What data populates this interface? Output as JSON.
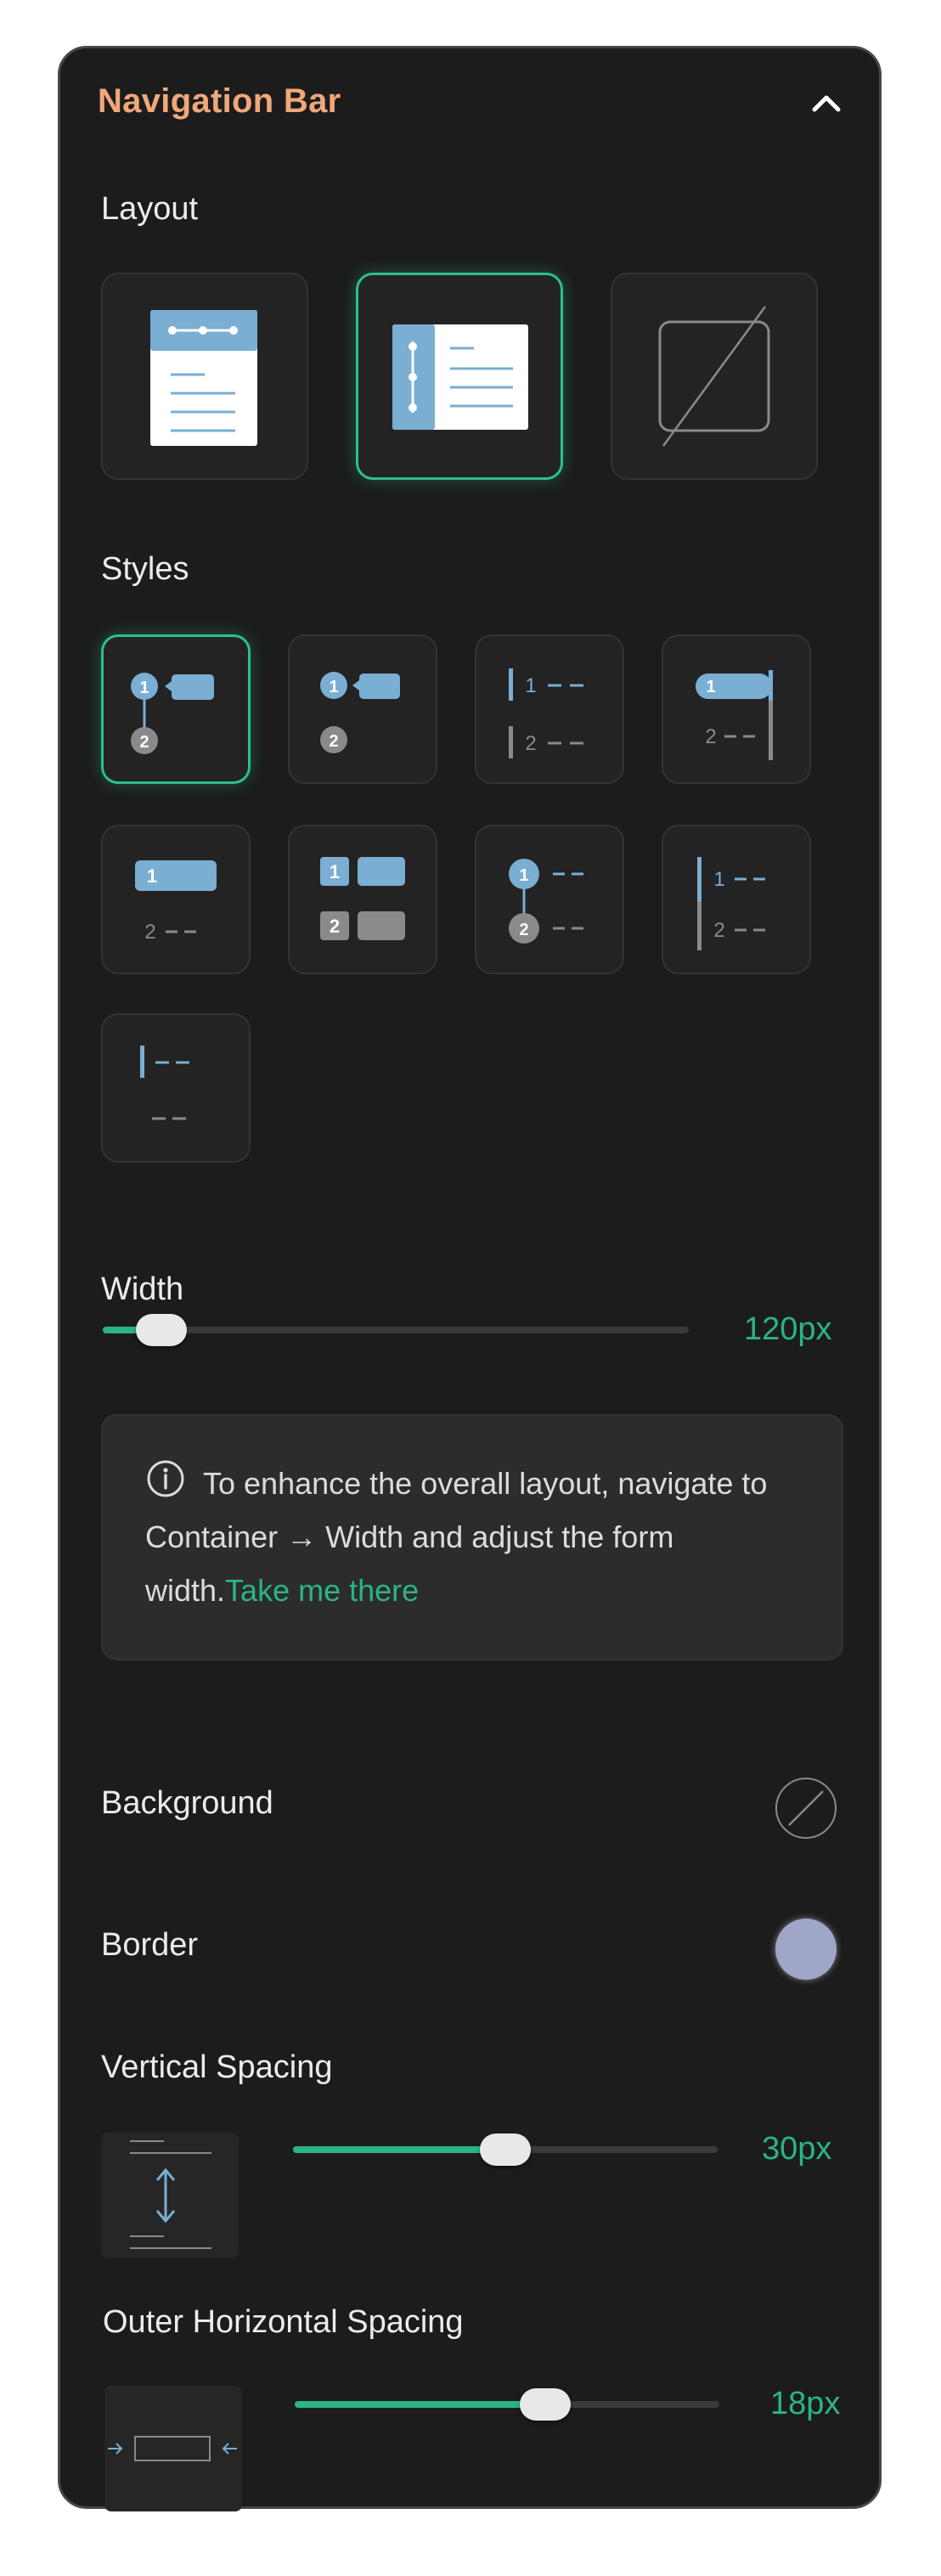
{
  "panel": {
    "title": "Navigation Bar",
    "collapse_icon": "chevron-up-icon"
  },
  "layout": {
    "label": "Layout",
    "options": [
      {
        "name": "top-navigation",
        "selected": false
      },
      {
        "name": "side-navigation",
        "selected": true
      },
      {
        "name": "none",
        "selected": false
      }
    ]
  },
  "styles": {
    "label": "Styles",
    "options": [
      {
        "name": "style-1",
        "selected": true
      },
      {
        "name": "style-2",
        "selected": false
      },
      {
        "name": "style-3",
        "selected": false
      },
      {
        "name": "style-4",
        "selected": false
      },
      {
        "name": "style-5",
        "selected": false
      },
      {
        "name": "style-6",
        "selected": false
      },
      {
        "name": "style-7",
        "selected": false
      },
      {
        "name": "style-8",
        "selected": false
      },
      {
        "name": "style-9",
        "selected": false
      }
    ],
    "glyph_1": "1",
    "glyph_2": "2"
  },
  "width": {
    "label": "Width",
    "value_text": "120px",
    "slider_fraction": 0.1
  },
  "info": {
    "icon": "info-icon",
    "text": "To enhance the overall layout, navigate to Container → Width and adjust the form width.",
    "link_text": "Take me there"
  },
  "background": {
    "label": "Background",
    "swatch": "none"
  },
  "border": {
    "label": "Border",
    "swatch_color": "#a0a6c8"
  },
  "vertical_spacing": {
    "label": "Vertical Spacing",
    "value_text": "30px",
    "slider_fraction": 0.5
  },
  "outer_horizontal_spacing": {
    "label": "Outer Horizontal Spacing",
    "value_text": "18px",
    "slider_fraction": 0.59
  },
  "colors": {
    "accent": "#2bb38a",
    "title": "#f0a77a",
    "illustration_blue": "#7aaed3"
  }
}
